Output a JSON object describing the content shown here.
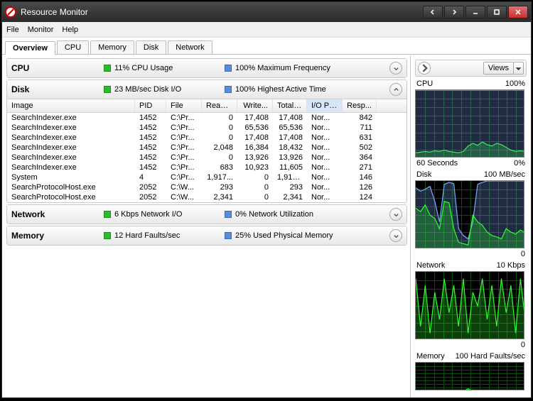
{
  "window": {
    "title": "Resource Monitor"
  },
  "menu": {
    "file": "File",
    "monitor": "Monitor",
    "help": "Help"
  },
  "tabs": {
    "overview": "Overview",
    "cpu": "CPU",
    "memory": "Memory",
    "disk": "Disk",
    "network": "Network"
  },
  "sections": {
    "cpu": {
      "label": "CPU",
      "m1": "11% CPU Usage",
      "m2": "100% Maximum Frequency"
    },
    "disk": {
      "label": "Disk",
      "m1": "23 MB/sec Disk I/O",
      "m2": "100% Highest Active Time"
    },
    "network": {
      "label": "Network",
      "m1": "6 Kbps Network I/O",
      "m2": "0% Network Utilization"
    },
    "memory": {
      "label": "Memory",
      "m1": "12 Hard Faults/sec",
      "m2": "25% Used Physical Memory"
    }
  },
  "disk_table": {
    "headers": {
      "image": "Image",
      "pid": "PID",
      "file": "File",
      "read": "Read ...",
      "write": "Write...",
      "total": "Total ...",
      "iop": "I/O Pr...",
      "resp": "Resp..."
    },
    "rows": [
      {
        "image": "SearchIndexer.exe",
        "pid": "1452",
        "file": "C:\\Pr...",
        "read": "0",
        "write": "17,408",
        "total": "17,408",
        "iop": "Nor...",
        "resp": "842"
      },
      {
        "image": "SearchIndexer.exe",
        "pid": "1452",
        "file": "C:\\Pr...",
        "read": "0",
        "write": "65,536",
        "total": "65,536",
        "iop": "Nor...",
        "resp": "711"
      },
      {
        "image": "SearchIndexer.exe",
        "pid": "1452",
        "file": "C:\\Pr...",
        "read": "0",
        "write": "17,408",
        "total": "17,408",
        "iop": "Nor...",
        "resp": "631"
      },
      {
        "image": "SearchIndexer.exe",
        "pid": "1452",
        "file": "C:\\Pr...",
        "read": "2,048",
        "write": "16,384",
        "total": "18,432",
        "iop": "Nor...",
        "resp": "502"
      },
      {
        "image": "SearchIndexer.exe",
        "pid": "1452",
        "file": "C:\\Pr...",
        "read": "0",
        "write": "13,926",
        "total": "13,926",
        "iop": "Nor...",
        "resp": "364"
      },
      {
        "image": "SearchIndexer.exe",
        "pid": "1452",
        "file": "C:\\Pr...",
        "read": "683",
        "write": "10,923",
        "total": "11,605",
        "iop": "Nor...",
        "resp": "271"
      },
      {
        "image": "System",
        "pid": "4",
        "file": "C:\\Pr...",
        "read": "1,917...",
        "write": "0",
        "total": "1,917...",
        "iop": "Nor...",
        "resp": "146"
      },
      {
        "image": "SearchProtocolHost.exe",
        "pid": "2052",
        "file": "C:\\W...",
        "read": "293",
        "write": "0",
        "total": "293",
        "iop": "Nor...",
        "resp": "126"
      },
      {
        "image": "SearchProtocolHost.exe",
        "pid": "2052",
        "file": "C:\\W...",
        "read": "2,341",
        "write": "0",
        "total": "2,341",
        "iop": "Nor...",
        "resp": "124"
      }
    ]
  },
  "right": {
    "views": "Views",
    "charts": {
      "cpu": {
        "title": "CPU",
        "max": "100%",
        "bl": "60 Seconds",
        "br": "0%"
      },
      "disk": {
        "title": "Disk",
        "max": "100 MB/sec",
        "br": "0"
      },
      "network": {
        "title": "Network",
        "max": "10 Kbps",
        "br": "0"
      },
      "memory": {
        "title": "Memory",
        "max": "100 Hard Faults/sec"
      }
    }
  },
  "chart_data": [
    {
      "type": "line",
      "title": "CPU",
      "ylabel": "%",
      "ylim": [
        0,
        100
      ],
      "xlabel": "60 Seconds",
      "series": [
        {
          "name": "CPU Usage",
          "color": "#2dff2d",
          "values": [
            8,
            9,
            10,
            9,
            11,
            10,
            12,
            10,
            9,
            8,
            10,
            18,
            22,
            19,
            24,
            20,
            18,
            22,
            20,
            16,
            12,
            10,
            11,
            10
          ]
        },
        {
          "name": "Max Frequency",
          "color": "#7aaaff",
          "values": [
            100,
            100,
            100,
            100,
            100,
            100,
            100,
            100,
            100,
            100,
            100,
            100,
            100,
            100,
            100,
            100,
            100,
            100,
            100,
            100,
            100,
            100,
            100,
            100
          ]
        }
      ]
    },
    {
      "type": "line",
      "title": "Disk",
      "ylabel": "MB/sec",
      "ylim": [
        0,
        100
      ],
      "series": [
        {
          "name": "Highest Active Time",
          "color": "#7aaaff",
          "values": [
            90,
            85,
            88,
            92,
            70,
            40,
            95,
            98,
            96,
            30,
            20,
            15,
            40,
            95,
            98,
            100,
            100,
            100,
            100,
            100,
            100,
            100,
            100,
            100
          ]
        },
        {
          "name": "Disk I/O",
          "color": "#2dff2d",
          "values": [
            60,
            55,
            65,
            50,
            45,
            30,
            70,
            68,
            30,
            10,
            8,
            6,
            50,
            40,
            35,
            25,
            20,
            18,
            15,
            30,
            25,
            22,
            28,
            24
          ]
        }
      ]
    },
    {
      "type": "line",
      "title": "Network",
      "ylabel": "Kbps",
      "ylim": [
        0,
        10
      ],
      "series": [
        {
          "name": "Network I/O",
          "color": "#2dff2d",
          "values": [
            9,
            2,
            8,
            1,
            7,
            3,
            9,
            4,
            8,
            2,
            9,
            1,
            7,
            5,
            9,
            3,
            8,
            2,
            9,
            4,
            8,
            1,
            9,
            3
          ]
        }
      ]
    },
    {
      "type": "line",
      "title": "Memory",
      "ylabel": "Hard Faults/sec",
      "ylim": [
        0,
        100
      ],
      "series": [
        {
          "name": "Hard Faults",
          "color": "#2dff2d",
          "values": [
            0,
            0,
            0,
            0,
            0,
            0,
            0,
            0,
            0,
            0,
            0,
            8,
            0,
            0,
            0,
            0,
            0,
            0,
            0,
            0,
            0,
            0,
            0,
            0
          ]
        }
      ]
    }
  ]
}
